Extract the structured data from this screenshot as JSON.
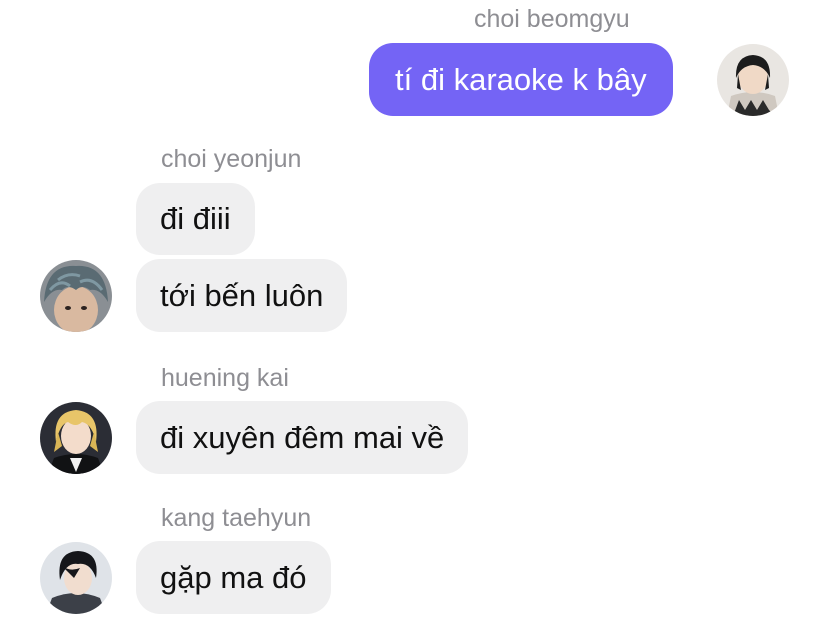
{
  "messages": [
    {
      "sender": "choi beomgyu",
      "texts": [
        "tí đi karaoke k bây"
      ],
      "avatar_icon": "avatar-beomgyu",
      "outgoing": true
    },
    {
      "sender": "choi yeonjun",
      "texts": [
        "đi điii",
        "tới bến luôn"
      ],
      "avatar_icon": "avatar-yeonjun",
      "outgoing": false
    },
    {
      "sender": "huening kai",
      "texts": [
        "đi xuyên đêm mai về"
      ],
      "avatar_icon": "avatar-hueningkai",
      "outgoing": false
    },
    {
      "sender": "kang taehyun",
      "texts": [
        "gặp ma đó"
      ],
      "avatar_icon": "avatar-taehyun",
      "outgoing": false
    }
  ],
  "colors": {
    "outgoing_bubble": "#7464f5",
    "incoming_bubble": "#efeff0",
    "sender_name": "#8e8e93"
  }
}
